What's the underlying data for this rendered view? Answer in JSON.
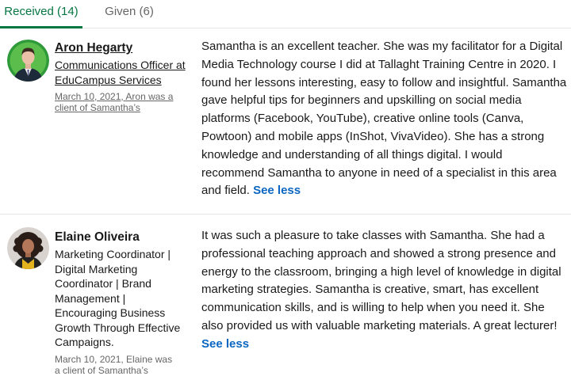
{
  "tabs": [
    {
      "label": "Received (14)",
      "active": true
    },
    {
      "label": "Given (6)",
      "active": false
    }
  ],
  "colors": {
    "accent_green": "#057642",
    "link_blue": "#0a66c2",
    "muted_text": "#666666",
    "divider": "#e6e6e6"
  },
  "recommendations": [
    {
      "name": "Aron Hegarty",
      "headline": "Communications Officer at EduCampus Services",
      "date": "March 10, 2021, Aron was a client of Samantha’s",
      "text": "Samantha is an excellent teacher. She was my facilitator for a Digital Media Technology course I did at Tallaght Training Centre in 2020. I found her lessons interesting, easy to follow and insightful. Samantha gave helpful tips for beginners and upskilling on social media platforms (Facebook, YouTube), creative online tools (Canva, Powtoon) and mobile apps (InShot, VivaVideo). She has a strong knowledge and understanding of all things digital. I would recommend Samantha to anyone in need of a specialist in this area and field.",
      "toggle": "See less",
      "avatar_icon": "profile-photo-man-suit"
    },
    {
      "name": "Elaine Oliveira",
      "headline": "Marketing Coordinator | Digital Marketing Coordinator | Brand Management | Encouraging Business Growth Through Effective Campaigns.",
      "date": "March 10, 2021, Elaine was a client of Samantha’s",
      "text": "It was such a pleasure to take classes with Samantha. She had a professional teaching approach and showed a strong presence and energy to the classroom, bringing a high level of knowledge in digital marketing strategies. Samantha is creative, smart, has excellent communication skills, and is willing to help when you need it. She also provided us with valuable marketing materials. A great lecturer!",
      "toggle": "See less",
      "avatar_icon": "profile-photo-woman-curly-hair"
    }
  ]
}
